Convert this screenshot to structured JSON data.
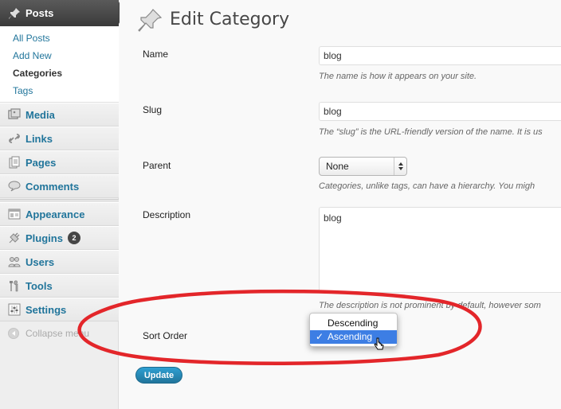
{
  "sidebar": {
    "posts_header": "Posts",
    "posts_sub": [
      {
        "label": "All Posts"
      },
      {
        "label": "Add New"
      },
      {
        "label": "Categories"
      },
      {
        "label": "Tags"
      }
    ],
    "menu": [
      {
        "label": "Media",
        "icon": "media-icon"
      },
      {
        "label": "Links",
        "icon": "links-icon"
      },
      {
        "label": "Pages",
        "icon": "pages-icon"
      },
      {
        "label": "Comments",
        "icon": "comments-icon"
      },
      {
        "label": "Appearance",
        "icon": "appearance-icon"
      },
      {
        "label": "Plugins",
        "icon": "plugins-icon",
        "badge": "2"
      },
      {
        "label": "Users",
        "icon": "users-icon"
      },
      {
        "label": "Tools",
        "icon": "tools-icon"
      },
      {
        "label": "Settings",
        "icon": "settings-icon"
      }
    ],
    "collapse_label": "Collapse menu"
  },
  "page": {
    "title": "Edit Category",
    "name": {
      "label": "Name",
      "value": "blog",
      "help": "The name is how it appears on your site."
    },
    "slug": {
      "label": "Slug",
      "value": "blog",
      "help": "The “slug” is the URL-friendly version of the name. It is us"
    },
    "parent": {
      "label": "Parent",
      "value": "None",
      "help": "Categories, unlike tags, can have a hierarchy. You migh"
    },
    "description": {
      "label": "Description",
      "value": "blog",
      "help": "The description is not prominent by default, however som"
    },
    "sort_order": {
      "label": "Sort Order",
      "options": [
        "Descending",
        "Ascending"
      ],
      "selected": "Ascending",
      "check": "✓"
    },
    "update_button": "Update"
  },
  "colors": {
    "link": "#21759b",
    "highlight": "#3d7ee4",
    "annotation": "#e3262a",
    "button": "#21759b"
  }
}
